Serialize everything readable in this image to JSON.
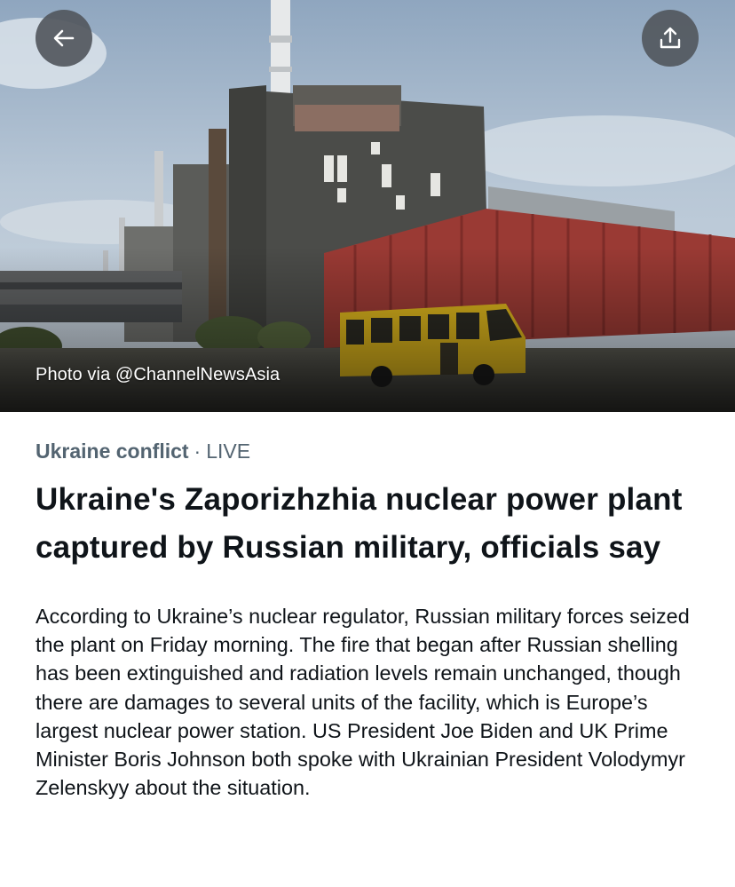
{
  "hero": {
    "photo_credit": "Photo via @ChannelNewsAsia",
    "back_icon": "arrow-left-icon",
    "share_icon": "share-upload-icon"
  },
  "article": {
    "topic": "Ukraine conflict",
    "separator": "·",
    "status": "LIVE",
    "headline": "Ukraine's Zaporizhzhia nuclear power plant captured by Russian military, officials say",
    "body": "According to Ukraine’s nuclear regulator, Russian military forces seized the plant on Friday morning. The fire that began after Russian shelling has been extinguished and radiation levels remain unchanged, though there are damages to several units of the facility, which is Europe’s largest nuclear power station. US President Joe Biden and UK Prime Minister Boris Johnson both spoke with Ukrainian President Volodymyr Zelenskyy about the situation."
  },
  "colors": {
    "secondary_text": "#536471",
    "primary_text": "#0f1419",
    "button_overlay": "#53585e"
  }
}
